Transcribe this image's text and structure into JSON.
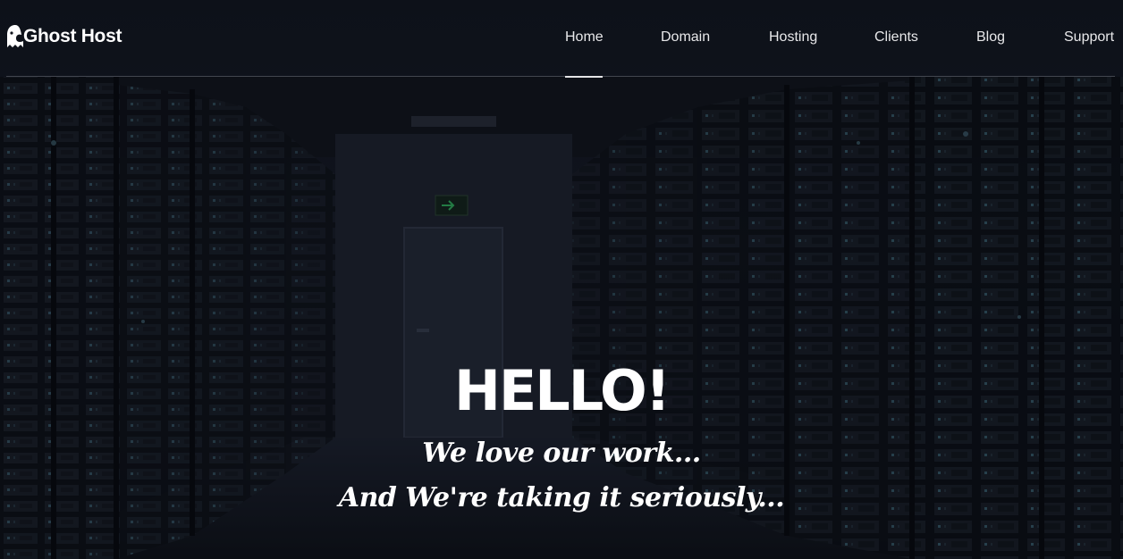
{
  "brand": {
    "name": "Ghost Host",
    "icon": "ghost-icon"
  },
  "nav": {
    "items": [
      {
        "label": "Home",
        "active": true
      },
      {
        "label": "Domain",
        "active": false
      },
      {
        "label": "Hosting",
        "active": false
      },
      {
        "label": "Clients",
        "active": false
      },
      {
        "label": "Blog",
        "active": false
      },
      {
        "label": "Support",
        "active": false
      }
    ]
  },
  "hero": {
    "title": "HELLO!",
    "line1": "We love our work...",
    "line2": "And We're taking it seriously..."
  },
  "colors": {
    "text": "#ffffff",
    "background": "#121620",
    "exit_sign": "#2fae5a"
  }
}
